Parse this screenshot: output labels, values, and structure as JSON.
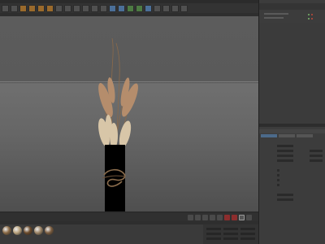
{
  "menus": [],
  "viewport_menus": [],
  "attribute_tabs": [],
  "object_manager": {
    "rows": []
  },
  "colors": {
    "background": "#3a3a3a",
    "viewport_sky": "#5c5c5c",
    "viewport_floor": "#666666",
    "vase": "#000000",
    "plume": "#d8c6a8",
    "plume_pink": "#b58d6c",
    "active_tab": "#4c6a8a"
  },
  "icons": {
    "toolbar": [
      "undo-icon",
      "redo-icon",
      "select-icon",
      "move-icon",
      "scale-icon",
      "rotate-icon",
      "axis-x-icon",
      "axis-y-icon",
      "axis-z-icon",
      "world-icon",
      "render-view-icon",
      "render-icon",
      "render-settings-icon",
      "cube-icon",
      "pen-icon",
      "subdivision-icon",
      "array-icon",
      "deformer-icon",
      "floor-icon",
      "camera-icon",
      "light-icon"
    ],
    "playback": [
      "first-frame-icon",
      "prev-frame-icon",
      "play-icon",
      "next-frame-icon",
      "last-frame-icon",
      "record-icon",
      "autokey-icon",
      "keyframe-icon",
      "timeline-icon"
    ]
  },
  "materials": [
    {
      "name": "",
      "color": "#8a6a45"
    },
    {
      "name": "",
      "color": "#b9a27c"
    },
    {
      "name": "",
      "color": "#6b4a2a"
    },
    {
      "name": "",
      "color": "#9c8465"
    },
    {
      "name": "",
      "color": "#7b5d3f"
    }
  ]
}
